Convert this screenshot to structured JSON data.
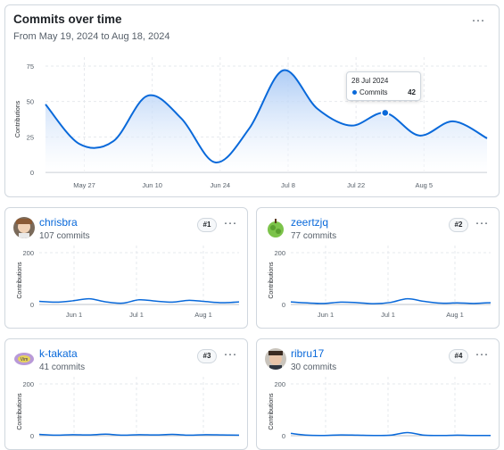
{
  "main": {
    "title": "Commits over time",
    "subtitle": "From May 19, 2024 to Aug 18, 2024",
    "more_label": "···",
    "chart_data": {
      "type": "area",
      "ylabel": "Contributions",
      "ylim": [
        0,
        75
      ],
      "y_ticks": [
        "0",
        "25",
        "50",
        "75"
      ],
      "x_ticks": [
        "May 27",
        "Jun 10",
        "Jun 24",
        "Jul 8",
        "Jul 22",
        "Aug 5"
      ],
      "series": [
        {
          "x": [
            "2024-05-19",
            "2024-05-26",
            "2024-06-02",
            "2024-06-09",
            "2024-06-16",
            "2024-06-23",
            "2024-06-30",
            "2024-07-07",
            "2024-07-14",
            "2024-07-21",
            "2024-07-28",
            "2024-08-04",
            "2024-08-11",
            "2024-08-18"
          ],
          "values": [
            48,
            20,
            22,
            54,
            38,
            7,
            31,
            72,
            45,
            33,
            42,
            26,
            36,
            24
          ]
        }
      ],
      "grid": true,
      "color": "#0969da"
    },
    "tooltip": {
      "date": "28 Jul 2024",
      "label": "Commits",
      "value": "42",
      "highlight_index": 10
    }
  },
  "contributors": [
    {
      "name": "chrisbra",
      "commits": "107 commits",
      "rank": "#1",
      "chart_data": {
        "type": "line",
        "ylabel": "Contributions",
        "ylim": [
          0,
          200
        ],
        "y_ticks": [
          "200",
          "0"
        ],
        "x_ticks": [
          "Jun 1",
          "Jul 1",
          "Aug 1"
        ],
        "values": [
          12,
          9,
          14,
          22,
          10,
          5,
          18,
          13,
          9,
          16,
          11,
          7,
          10
        ]
      }
    },
    {
      "name": "zeertzjq",
      "commits": "77 commits",
      "rank": "#2",
      "chart_data": {
        "type": "line",
        "ylabel": "Contributions",
        "ylim": [
          0,
          200
        ],
        "y_ticks": [
          "200",
          "0"
        ],
        "x_ticks": [
          "Jun 1",
          "Jul 1",
          "Aug 1"
        ],
        "values": [
          10,
          6,
          4,
          9,
          7,
          3,
          8,
          22,
          12,
          5,
          6,
          4,
          7
        ]
      }
    },
    {
      "name": "k-takata",
      "commits": "41 commits",
      "rank": "#3",
      "chart_data": {
        "type": "line",
        "ylabel": "Contributions",
        "ylim": [
          0,
          200
        ],
        "y_ticks": [
          "200",
          "0"
        ],
        "x_ticks": [],
        "values": [
          5,
          2,
          4,
          3,
          6,
          2,
          4,
          3,
          5,
          2,
          4,
          3,
          2
        ]
      }
    },
    {
      "name": "ribru17",
      "commits": "30 commits",
      "rank": "#4",
      "chart_data": {
        "type": "line",
        "ylabel": "Contributions",
        "ylim": [
          0,
          200
        ],
        "y_ticks": [
          "200",
          "0"
        ],
        "x_ticks": [],
        "values": [
          9,
          2,
          1,
          3,
          2,
          1,
          2,
          12,
          2,
          1,
          2,
          1,
          1
        ]
      }
    }
  ]
}
